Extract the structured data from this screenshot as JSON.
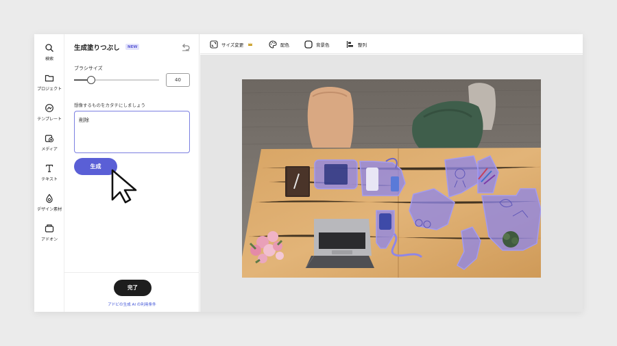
{
  "sidebar": {
    "items": [
      {
        "label": "検索",
        "icon": "search-icon"
      },
      {
        "label": "プロジェクト",
        "icon": "folder-icon"
      },
      {
        "label": "テンプレート",
        "icon": "template-icon"
      },
      {
        "label": "メディア",
        "icon": "media-icon"
      },
      {
        "label": "テキスト",
        "icon": "text-icon"
      },
      {
        "label": "デザイン素材",
        "icon": "shapes-icon"
      },
      {
        "label": "アドオン",
        "icon": "addon-icon"
      }
    ]
  },
  "panel": {
    "title": "生成塗りつぶし",
    "badge": "NEW",
    "brush_label": "ブラシサイズ",
    "brush_value": "40",
    "brush_level": 0.2,
    "prompt_label": "想像するものをカタチにしましょう",
    "prompt_value": "削除",
    "generate_label": "生成",
    "done_label": "完了",
    "terms_link": "アドビの生成 AI の利用条件"
  },
  "toolbar": {
    "items": [
      {
        "label": "サイズ変更",
        "icon": "resize-icon"
      },
      {
        "label": "配色",
        "icon": "palette-icon"
      },
      {
        "label": "背景色",
        "icon": "background-color-icon"
      },
      {
        "label": "整列",
        "icon": "align-icon"
      }
    ],
    "premium_icon": "crown-icon"
  },
  "colors": {
    "accent": "#5a5fd6",
    "selection_overlay": "#8f86e6",
    "done_button": "#1e1e1e"
  }
}
